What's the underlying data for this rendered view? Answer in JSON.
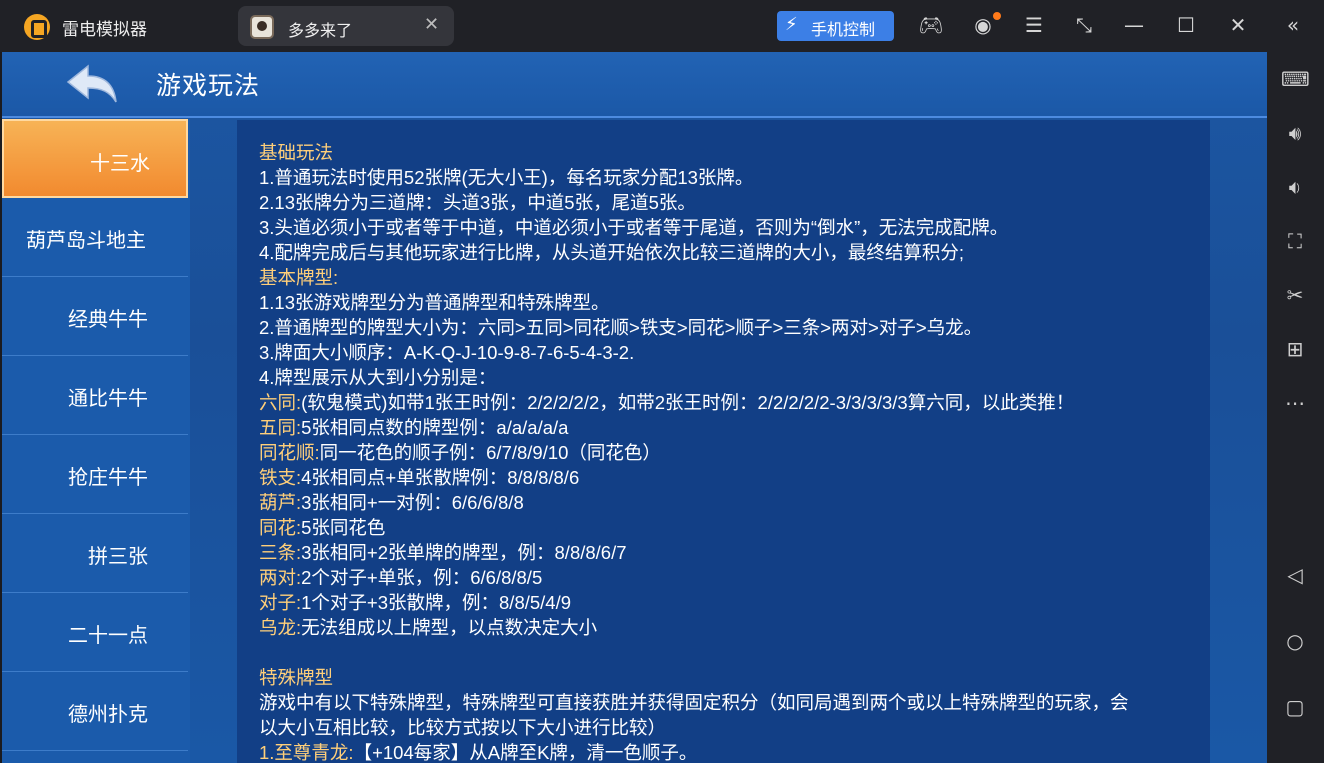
{
  "window": {
    "app_title": "雷电模拟器",
    "tab_label": "多多来了",
    "phone_control_label": "手机控制"
  },
  "game": {
    "page_title": "游戏玩法",
    "sidebar": [
      {
        "label": "十三水",
        "active": true
      },
      {
        "label": "葫芦岛斗地主",
        "active": false
      },
      {
        "label": "经典牛牛",
        "active": false
      },
      {
        "label": "通比牛牛",
        "active": false
      },
      {
        "label": "抢庄牛牛",
        "active": false
      },
      {
        "label": "拼三张",
        "active": false
      },
      {
        "label": "二十一点",
        "active": false
      },
      {
        "label": "德州扑克",
        "active": false
      }
    ],
    "rules": {
      "basic_heading": "基础玩法",
      "basic": [
        "1.普通玩法时使用52张牌(无大小王)，每名玩家分配13张牌。",
        "2.13张牌分为三道牌：头道3张，中道5张，尾道5张。",
        "3.头道必须小于或者等于中道，中道必须小于或者等于尾道，否则为“倒水”，无法完成配牌。",
        "4.配牌完成后与其他玩家进行比牌，从头道开始依次比较三道牌的大小，最终结算积分;"
      ],
      "types_heading": "基本牌型:",
      "types": [
        "1.13张游戏牌型分为普通牌型和特殊牌型。",
        "2.普通牌型的牌型大小为：六同>五同>同花顺>铁支>同花>顺子>三条>两对>对子>乌龙。",
        "3.牌面大小顺序：A-K-Q-J-10-9-8-7-6-5-4-3-2.",
        "4.牌型展示从大到小分别是："
      ],
      "hands": [
        {
          "name": "六同:",
          "desc": "(软鬼模式)如带1张王时例：2/2/2/2/2，如带2张王时例：2/2/2/2/2-3/3/3/3/3算六同，以此类推！"
        },
        {
          "name": "五同:",
          "desc": "5张相同点数的牌型例：a/a/a/a/a"
        },
        {
          "name": "同花顺:",
          "desc": "同一花色的顺子例：6/7/8/9/10（同花色）"
        },
        {
          "name": "铁支:",
          "desc": "4张相同点+单张散牌例：8/8/8/8/6"
        },
        {
          "name": "葫芦:",
          "desc": "3张相同+一对例：6/6/6/8/8"
        },
        {
          "name": "同花:",
          "desc": "5张同花色"
        },
        {
          "name": "三条:",
          "desc": "3张相同+2张单牌的牌型，例：8/8/8/6/7"
        },
        {
          "name": "两对:",
          "desc": "2个对子+单张，例：6/6/8/8/5"
        },
        {
          "name": "对子:",
          "desc": "1个对子+3张散牌，例：8/8/5/4/9"
        },
        {
          "name": "乌龙:",
          "desc": "无法组成以上牌型，以点数决定大小"
        }
      ],
      "special_heading": "特殊牌型",
      "special_line1": "游戏中有以下特殊牌型，特殊牌型可直接获胜并获得固定积分（如同局遇到两个或以上特殊牌型的玩家，会",
      "special_line2": "以大小互相比较，比较方式按以下大小进行比较）",
      "special_first_name": "1.至尊青龙:",
      "special_first_desc": "【+104每家】从A牌至K牌，清一色顺子。"
    }
  },
  "icons": {
    "titlebar": [
      "gamepad-icon",
      "user-icon",
      "menu-icon",
      "resize-icon",
      "minimize-icon",
      "maximize-icon",
      "close-icon",
      "collapse-icon"
    ],
    "rightbar": [
      "keyboard-icon",
      "volume-up-icon",
      "volume-down-icon",
      "screenshot-icon",
      "scissors-icon",
      "add-window-icon",
      "more-icon",
      "back-nav-icon",
      "home-nav-icon",
      "recent-apps-icon"
    ]
  },
  "colors": {
    "highlight": "#ffcf7a",
    "active_tab": "#f28a2f",
    "phone_button": "#3c7fe6"
  }
}
